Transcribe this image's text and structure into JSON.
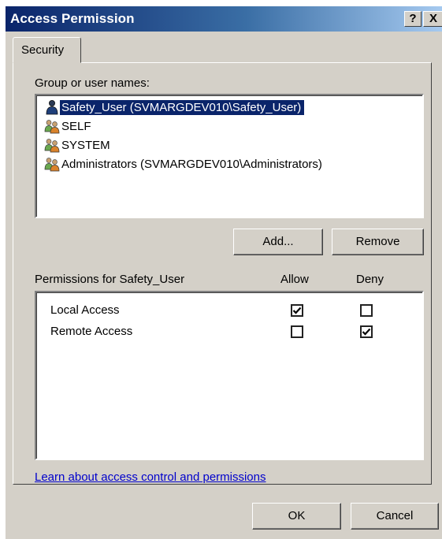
{
  "window": {
    "title": "Access Permission",
    "help_button": "?",
    "close_button": "X"
  },
  "tabs": [
    {
      "label": "Security"
    }
  ],
  "users": {
    "label": "Group or user names:",
    "items": [
      {
        "name": "Safety_User (SVMARGDEV010\\Safety_User)",
        "icon": "user-icon",
        "selected": true
      },
      {
        "name": "SELF",
        "icon": "group-icon",
        "selected": false
      },
      {
        "name": "SYSTEM",
        "icon": "group-icon",
        "selected": false
      },
      {
        "name": "Administrators (SVMARGDEV010\\Administrators)",
        "icon": "group-icon",
        "selected": false
      }
    ]
  },
  "buttons": {
    "add": "Add...",
    "remove": "Remove",
    "ok": "OK",
    "cancel": "Cancel"
  },
  "permissions": {
    "label": "Permissions for Safety_User",
    "allow_header": "Allow",
    "deny_header": "Deny",
    "rows": [
      {
        "name": "Local Access",
        "allow": true,
        "deny": false
      },
      {
        "name": "Remote Access",
        "allow": false,
        "deny": true
      }
    ]
  },
  "link": {
    "text": "Learn about access control and permissions"
  },
  "colors": {
    "selection": "#0a246a",
    "dialog_bg": "#d4d0c8",
    "link": "#0000cc"
  }
}
